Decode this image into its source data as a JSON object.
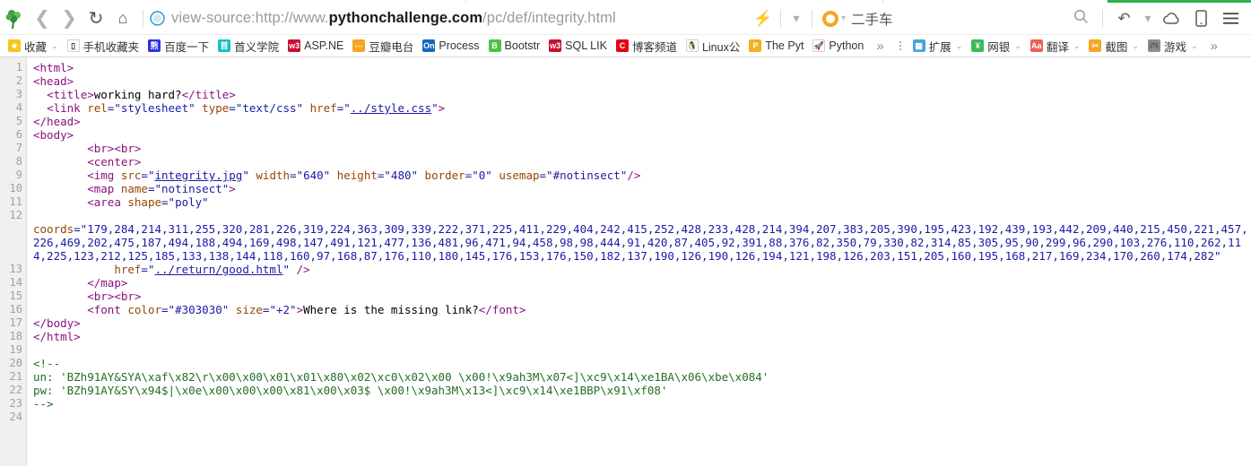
{
  "browser": {
    "nav": {
      "back_icon": "chevron-left-icon",
      "forward_icon": "chevron-right-icon",
      "reload_icon": "reload-icon",
      "home_icon": "home-icon",
      "security_icon": "shield-icon",
      "url_prefix": "view-source:http://www.",
      "url_host_bold": "pythonchallenge.com",
      "url_path": "/pc/def/integrity.html",
      "full_url": "view-source:http://www.pythonchallenge.com/pc/def/integrity.html",
      "bolt_icon": "lightning-bolt-icon",
      "dropdown_icon": "chevron-down-icon",
      "search_engine_icon": "orange-circle-icon",
      "search_value": "二手车",
      "search_icon": "search-icon",
      "undo_icon": "undo-arrow-icon",
      "cloud_icon": "cloud-icon",
      "mobile_icon": "mobile-device-icon",
      "menu_icon": "hamburger-menu-icon"
    },
    "bookmarks": [
      {
        "label": "收藏",
        "icon": "star-favorite-icon",
        "caret": true,
        "color": "#f5c518",
        "glyph": "★"
      },
      {
        "label": "手机收藏夹",
        "icon": "mobile-bookmarks-icon",
        "caret": false,
        "color": "#ffffff",
        "glyph": "▯"
      },
      {
        "label": "百度一下",
        "icon": "baidu-icon",
        "caret": false,
        "color": "#2932e1",
        "glyph": "熊"
      },
      {
        "label": "首义学院",
        "icon": "shouyi-college-icon",
        "caret": false,
        "color": "#19c0c0",
        "glyph": "首"
      },
      {
        "label": "ASP.NE",
        "icon": "w3school-icon",
        "caret": false,
        "color": "#c8102e",
        "glyph": "w3"
      },
      {
        "label": "豆瓣电台",
        "icon": "douban-fm-icon",
        "caret": false,
        "color": "#f5a623",
        "glyph": "⋯"
      },
      {
        "label": "Process",
        "icon": "on-process-icon",
        "caret": false,
        "color": "#1268c3",
        "glyph": "On"
      },
      {
        "label": "Bootstr",
        "icon": "bootstrap-icon",
        "caret": false,
        "color": "#4cc24c",
        "glyph": "B"
      },
      {
        "label": "SQL LIK",
        "icon": "w3school-icon",
        "caret": false,
        "color": "#c8102e",
        "glyph": "w3"
      },
      {
        "label": "博客频道",
        "icon": "csdn-icon",
        "caret": false,
        "color": "#e60012",
        "glyph": "C"
      },
      {
        "label": "Linux公",
        "icon": "linux-tux-icon",
        "caret": false,
        "color": "#ffffff",
        "glyph": "🐧"
      },
      {
        "label": "The Pyt",
        "icon": "python-doc-icon",
        "caret": false,
        "color": "#f2b01e",
        "glyph": "P"
      },
      {
        "label": "Python",
        "icon": "rocket-icon",
        "caret": false,
        "color": "#ffffff",
        "glyph": "🚀"
      }
    ],
    "bookmarks_overflow": "»",
    "toolbar_right": [
      {
        "label": "扩展",
        "icon": "extensions-icon",
        "caret": true,
        "color": "#4aa3df",
        "glyph": "▦"
      },
      {
        "label": "网银",
        "icon": "online-banking-icon",
        "caret": true,
        "color": "#3dba5a",
        "glyph": "¥"
      },
      {
        "label": "翻译",
        "icon": "translate-icon",
        "caret": true,
        "color": "#e8605a",
        "glyph": "Aa"
      },
      {
        "label": "截图",
        "icon": "screenshot-icon",
        "caret": true,
        "color": "#f5a623",
        "glyph": "✂"
      },
      {
        "label": "游戏",
        "icon": "games-icon",
        "caret": true,
        "color": "#8d8d8d",
        "glyph": "🎮"
      }
    ],
    "toolbar_right_overflow": "»"
  },
  "source": {
    "lines": [
      {
        "n": "1",
        "parts": [
          {
            "c": "tag",
            "t": "<html>"
          }
        ]
      },
      {
        "n": "2",
        "parts": [
          {
            "c": "tag",
            "t": "<head>"
          }
        ]
      },
      {
        "n": "3",
        "parts": [
          {
            "c": "tag",
            "t": "  <title>"
          },
          {
            "c": "txt",
            "t": "working hard?"
          },
          {
            "c": "tag",
            "t": "</title>"
          }
        ]
      },
      {
        "n": "4",
        "parts": [
          {
            "c": "tag",
            "t": "  <link "
          },
          {
            "c": "attr",
            "t": "rel"
          },
          {
            "c": "val",
            "t": "=\"stylesheet\""
          },
          {
            "c": "attr",
            "t": " type"
          },
          {
            "c": "val",
            "t": "=\"text/css\""
          },
          {
            "c": "attr",
            "t": " href"
          },
          {
            "c": "val",
            "t": "=\""
          },
          {
            "c": "lnk",
            "t": "../style.css"
          },
          {
            "c": "val",
            "t": "\""
          },
          {
            "c": "tag",
            "t": ">"
          }
        ]
      },
      {
        "n": "5",
        "parts": [
          {
            "c": "tag",
            "t": "</head>"
          }
        ]
      },
      {
        "n": "6",
        "parts": [
          {
            "c": "tag",
            "t": "<body>"
          }
        ]
      },
      {
        "n": "7",
        "parts": [
          {
            "c": "tag",
            "t": "        <br><br>"
          }
        ]
      },
      {
        "n": "8",
        "parts": [
          {
            "c": "tag",
            "t": "        <center>"
          }
        ]
      },
      {
        "n": "9",
        "parts": [
          {
            "c": "tag",
            "t": "        <img "
          },
          {
            "c": "attr",
            "t": "src"
          },
          {
            "c": "val",
            "t": "=\""
          },
          {
            "c": "lnk",
            "t": "integrity.jpg"
          },
          {
            "c": "val",
            "t": "\""
          },
          {
            "c": "attr",
            "t": " width"
          },
          {
            "c": "val",
            "t": "=\"640\""
          },
          {
            "c": "attr",
            "t": " height"
          },
          {
            "c": "val",
            "t": "=\"480\""
          },
          {
            "c": "attr",
            "t": " border"
          },
          {
            "c": "val",
            "t": "=\"0\""
          },
          {
            "c": "attr",
            "t": " usemap"
          },
          {
            "c": "val",
            "t": "=\"#notinsect\""
          },
          {
            "c": "tag",
            "t": "/>"
          }
        ]
      },
      {
        "n": "10",
        "parts": [
          {
            "c": "tag",
            "t": "        <map "
          },
          {
            "c": "attr",
            "t": "name"
          },
          {
            "c": "val",
            "t": "=\"notinsect\""
          },
          {
            "c": "tag",
            "t": ">"
          }
        ]
      },
      {
        "n": "11",
        "parts": [
          {
            "c": "tag",
            "t": "        <area "
          },
          {
            "c": "attr",
            "t": "shape"
          },
          {
            "c": "val",
            "t": "=\"poly\""
          }
        ]
      },
      {
        "n": "12",
        "parts": [
          {
            "c": "attr",
            "t": "\ncoords"
          },
          {
            "c": "val",
            "t": "=\"179,284,214,311,255,320,281,226,319,224,363,309,339,222,371,225,411,229,404,242,415,252,428,233,428,214,394,207,383,205,390,195,423,192,439,193,442,209,440,215,450,221,457,226,469,202,475,187,494,188,494,169,498,147,491,121,477,136,481,96,471,94,458,98,98,444,91,420,87,405,92,391,88,376,82,350,79,330,82,314,85,305,95,90,299,96,290,103,276,110,262,114,225,123,212,125,185,133,138,144,118,160,97,168,87,176,110,180,145,176,153,176,150,182,137,190,126,190,126,194,121,198,126,203,151,205,160,195,168,217,169,234,170,260,174,282\""
          }
        ]
      },
      {
        "n": "13",
        "parts": [
          {
            "c": "attr",
            "t": "            href"
          },
          {
            "c": "val",
            "t": "=\""
          },
          {
            "c": "lnk",
            "t": "../return/good.html"
          },
          {
            "c": "val",
            "t": "\""
          },
          {
            "c": "tag",
            "t": " />"
          }
        ]
      },
      {
        "n": "14",
        "parts": [
          {
            "c": "tag",
            "t": "        </map>"
          }
        ]
      },
      {
        "n": "15",
        "parts": [
          {
            "c": "tag",
            "t": "        <br><br>"
          }
        ]
      },
      {
        "n": "16",
        "parts": [
          {
            "c": "tag",
            "t": "        <font "
          },
          {
            "c": "attr",
            "t": "color"
          },
          {
            "c": "val",
            "t": "=\"#303030\""
          },
          {
            "c": "attr",
            "t": " size"
          },
          {
            "c": "val",
            "t": "=\"+2\""
          },
          {
            "c": "tag",
            "t": ">"
          },
          {
            "c": "txt",
            "t": "Where is the missing link?"
          },
          {
            "c": "tag",
            "t": "</font>"
          }
        ]
      },
      {
        "n": "17",
        "parts": [
          {
            "c": "tag",
            "t": "</body>"
          }
        ]
      },
      {
        "n": "18",
        "parts": [
          {
            "c": "tag",
            "t": "</html>"
          }
        ]
      },
      {
        "n": "19",
        "parts": [
          {
            "c": "txt",
            "t": ""
          }
        ]
      },
      {
        "n": "20",
        "parts": [
          {
            "c": "cmt",
            "t": "<!--"
          }
        ]
      },
      {
        "n": "21",
        "parts": [
          {
            "c": "cmt",
            "t": "un: 'BZh91AY&SYA\\xaf\\x82\\r\\x00\\x00\\x01\\x01\\x80\\x02\\xc0\\x02\\x00 \\x00!\\x9ah3M\\x07<]\\xc9\\x14\\xe1BA\\x06\\xbe\\x084'"
          }
        ]
      },
      {
        "n": "22",
        "parts": [
          {
            "c": "cmt",
            "t": "pw: 'BZh91AY&SY\\x94$|\\x0e\\x00\\x00\\x00\\x81\\x00\\x03$ \\x00!\\x9ah3M\\x13<]\\xc9\\x14\\xe1BBP\\x91\\xf08'"
          }
        ]
      },
      {
        "n": "23",
        "parts": [
          {
            "c": "cmt",
            "t": "-->"
          }
        ]
      },
      {
        "n": "24",
        "parts": [
          {
            "c": "txt",
            "t": ""
          }
        ]
      }
    ]
  }
}
